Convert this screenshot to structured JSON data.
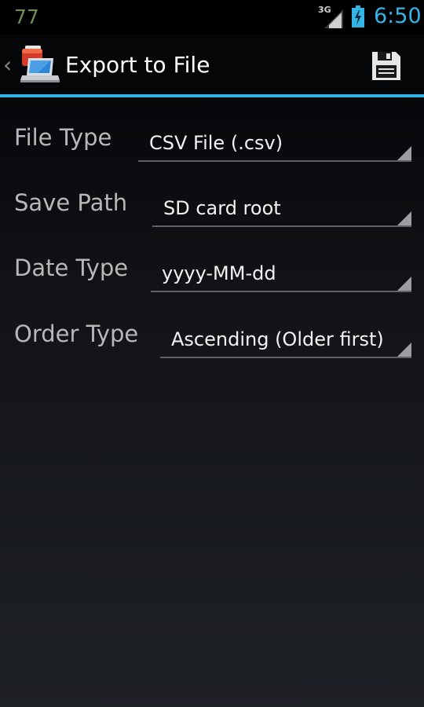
{
  "status_bar": {
    "notification_count": "77",
    "network_type": "3G",
    "time": "6:50"
  },
  "action_bar": {
    "back_icon": "chevron-left-icon",
    "app_icon": "export-app-icon",
    "title": "Export to File",
    "save_icon": "floppy-disk-icon"
  },
  "form": {
    "rows": [
      {
        "label": "File Type",
        "value": "CSV File (.csv)"
      },
      {
        "label": "Save Path",
        "value": "SD card root"
      },
      {
        "label": "Date Type",
        "value": "yyyy-MM-dd"
      },
      {
        "label": "Order Type",
        "value": "Ascending (Older first)"
      }
    ]
  },
  "colors": {
    "accent": "#33b5e5",
    "background_top": "#000000",
    "background_bottom": "#1e2125",
    "label_text": "#b8b8b8",
    "value_text": "#f2f2f2"
  }
}
